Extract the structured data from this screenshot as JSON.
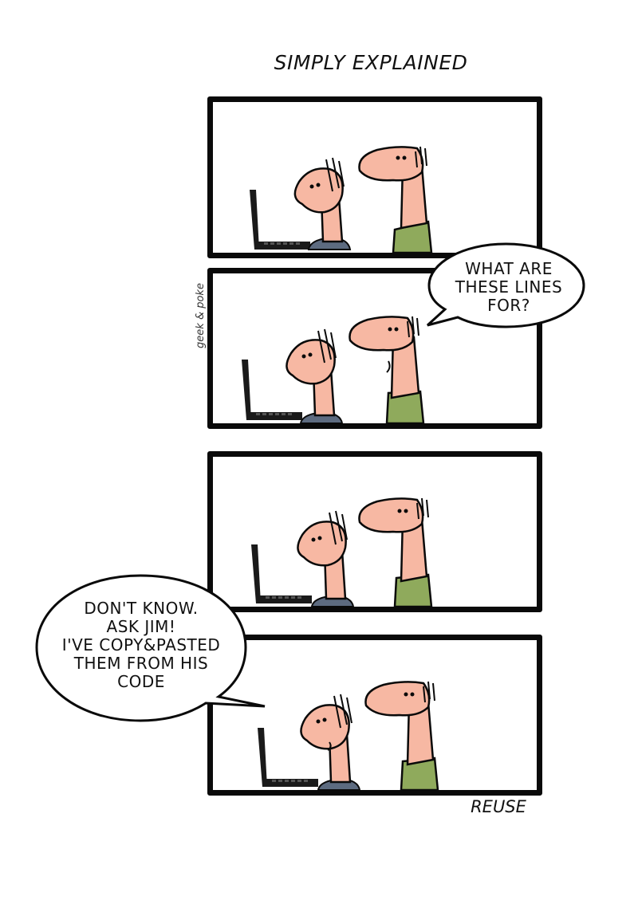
{
  "comic": {
    "title": "SIMPLY EXPLAINED",
    "caption": "REUSE",
    "signature": "geek & poke",
    "panels": [
      {
        "speaker": "none"
      },
      {
        "speaker": "standing-man",
        "bubble": [
          "WHAT ARE",
          "THESE LINES",
          "FOR?"
        ]
      },
      {
        "speaker": "none"
      },
      {
        "speaker": "seated-man",
        "bubble": [
          "DON'T KNOW.",
          "ASK JIM!",
          "I'VE COPY&PASTED",
          "THEM FROM HIS",
          "CODE"
        ]
      }
    ],
    "colors": {
      "skin": "#f7b8a3",
      "pants": "#8faa5c",
      "seated_shirt": "#5d6b80",
      "keyboard": "#1a1a1a",
      "ink": "#0a0a0a"
    }
  }
}
